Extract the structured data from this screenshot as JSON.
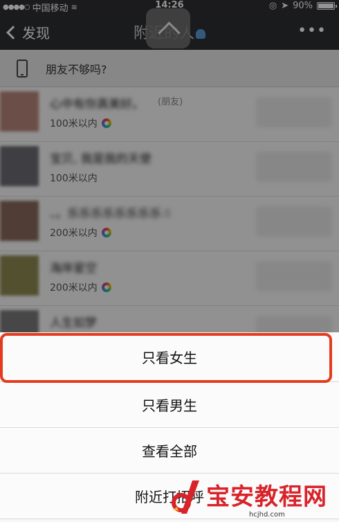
{
  "status_bar": {
    "signal_dots": "●●●●○",
    "carrier": "中国移动",
    "time": "14:26",
    "battery": "90%"
  },
  "navbar": {
    "back_label": "发现",
    "title": "附近的人",
    "more_label": "•••"
  },
  "banner": {
    "label": "朋友不够吗?"
  },
  "list": {
    "rows": [
      {
        "name": "心中有你真美好。",
        "tag": "(朋友)",
        "distance": "100米以内",
        "ring": true,
        "avatar_color": "#b9877a"
      },
      {
        "name": "宝贝, 我是我的天使",
        "tag": "",
        "distance": "100米以内",
        "ring": false,
        "avatar_color": "#6c6c74"
      },
      {
        "name": "、。乐乐乐乐乐乐乐乐☃",
        "tag": "",
        "distance": "200米以内",
        "ring": true,
        "avatar_color": "#8a6b5d"
      },
      {
        "name": "海岸星空",
        "tag": "",
        "distance": "200米以内",
        "ring": true,
        "avatar_color": "#8f8a52"
      },
      {
        "name": "人生如梦",
        "tag": "",
        "distance": "",
        "ring": false,
        "avatar_color": "#7b7b7b"
      }
    ]
  },
  "action_sheet": {
    "options": [
      "只看女生",
      "只看男生",
      "查看全部",
      "附近打招呼"
    ]
  },
  "watermark": {
    "brand": "宝安教程网",
    "url": "hcjhd.com"
  },
  "colors": {
    "nav_bg": "#2e2f32",
    "highlight": "#e53a1e",
    "watermark_red": "#d8232a"
  }
}
